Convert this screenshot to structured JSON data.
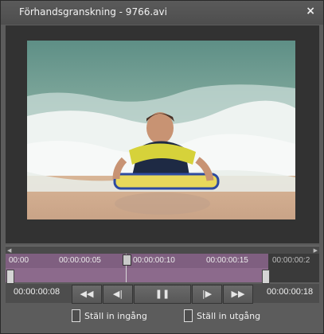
{
  "window": {
    "title": "Förhandsgranskning - 9766.avi",
    "close_label": "×"
  },
  "timeline": {
    "labels": [
      "00:00",
      "00:00:00:05",
      "00:00:00:10",
      "00:00:00:15",
      "00:00:00:2"
    ]
  },
  "controls": {
    "current_timecode": "00:00:00:08",
    "end_timecode": "00:00:00:18",
    "rewind": "◀◀",
    "step_back": "◀|",
    "pause": "❚❚",
    "step_forward": "|▶",
    "fast_forward": "▶▶"
  },
  "markers": {
    "set_in": "Ställ in ingång",
    "set_out": "Ställ in utgång"
  },
  "icons": [
    "close-icon",
    "rewind-icon",
    "step-back-icon",
    "pause-icon",
    "step-forward-icon",
    "fast-forward-icon",
    "marker-in-icon",
    "marker-out-icon"
  ]
}
